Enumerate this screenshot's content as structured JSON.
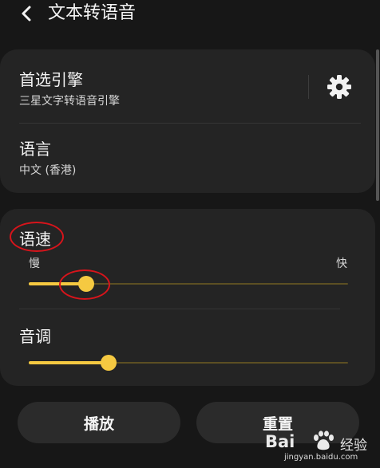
{
  "header": {
    "title": "文本转语音",
    "back_icon": "chevron-left-icon"
  },
  "engine": {
    "title": "首选引擎",
    "subtitle": "三星文字转语音引擎",
    "settings_icon": "gear-icon"
  },
  "language": {
    "title": "语言",
    "subtitle": "中文 (香港)"
  },
  "speech_rate": {
    "title": "语速",
    "min_label": "慢",
    "max_label": "快",
    "value": 0.18
  },
  "pitch": {
    "title": "音调",
    "value": 0.25
  },
  "buttons": {
    "play": "播放",
    "reset": "重置"
  },
  "watermark": {
    "brand": "Bai",
    "brand_suffix": "经验",
    "url": "jingyan.baidu.com"
  },
  "colors": {
    "accent": "#f5c941",
    "annotation": "#d8141b",
    "background": "#171717",
    "card": "#242424"
  }
}
